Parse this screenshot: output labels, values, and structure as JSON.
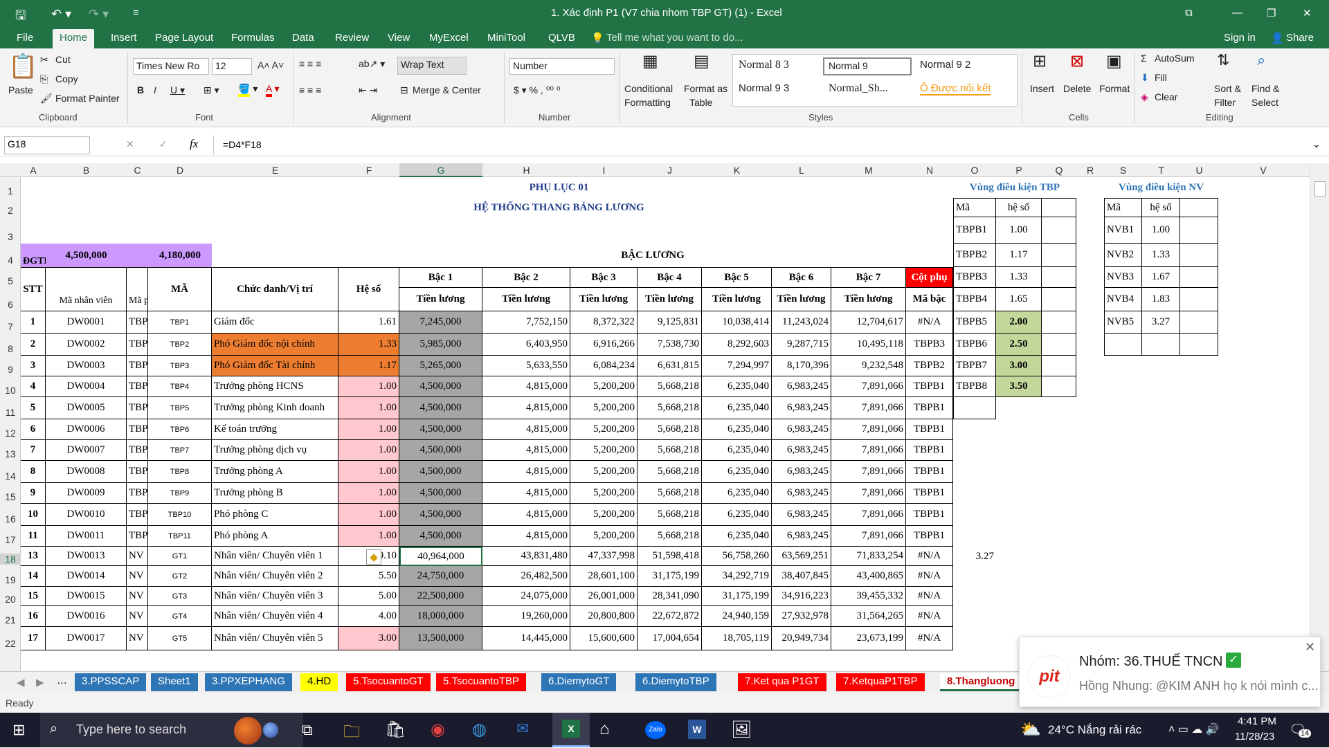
{
  "window": {
    "title": "1. Xác định P1  (V7 chia nhom TBP GT) (1) - Excel"
  },
  "menu": [
    "File",
    "Home",
    "Insert",
    "Page Layout",
    "Formulas",
    "Data",
    "Review",
    "View",
    "MyExcel",
    "MiniTool",
    "QLVB"
  ],
  "tell_me": "Tell me what you want to do...",
  "sign_in": "Sign in",
  "share": "Share",
  "ribbon": {
    "paste": "Paste",
    "cut": "Cut",
    "copy": "Copy",
    "format_painter": "Format Painter",
    "clipboard": "Clipboard",
    "font_name": "Times New Ro",
    "font_size": "12",
    "font": "Font",
    "wrap_text": "Wrap Text",
    "merge_center": "Merge & Center",
    "alignment": "Alignment",
    "number_format": "Number",
    "number": "Number",
    "conditional": "Conditional",
    "formatting": "Formatting",
    "format_as": "Format as",
    "table": "Table",
    "styles_list": [
      "Normal 8 3",
      "Normal 9",
      "Normal 9 2",
      "Normal 9 3",
      "Normal_Sh...",
      "Ô Được nối kết"
    ],
    "styles": "Styles",
    "insert": "Insert",
    "delete": "Delete",
    "format": "Format",
    "cells": "Cells",
    "autosum": "AutoSum",
    "fill": "Fill",
    "clear": "Clear",
    "sort_filter": "Sort &",
    "filter": "Filter",
    "find_select": "Find &",
    "select": "Select",
    "editing": "Editing"
  },
  "namebox": "G18",
  "formula": "=D4*F18",
  "columns": [
    "A",
    "B",
    "C",
    "D",
    "E",
    "F",
    "G",
    "H",
    "I",
    "J",
    "K",
    "L",
    "M",
    "N",
    "O",
    "P",
    "Q",
    "R",
    "S",
    "T",
    "U",
    "V"
  ],
  "rows": [
    "1",
    "2",
    "3",
    "4",
    "5",
    "6",
    "7",
    "8",
    "9",
    "10",
    "11",
    "12",
    "13",
    "14",
    "15",
    "16",
    "17",
    "18",
    "19",
    "20",
    "21",
    "22"
  ],
  "header": {
    "title1": "PHỤ LỤC 01",
    "title2": "HỆ THỐNG THANG BẢNG LƯƠNG",
    "bac_luong": "BẬC LƯƠNG",
    "dgtl": "ĐGTL",
    "dgtl_val1": "4,500,000",
    "dgtl_val2": "4,180,000",
    "stt": "STT",
    "ma_nv": "Mã nhân viên",
    "ma_ph": "Mã ph",
    "ma": "MÃ",
    "chuc_danh": "Chức danh/Vị trí",
    "he_so": "Hệ số",
    "bac": [
      "Bậc  1",
      "Bậc  2",
      "Bậc  3",
      "Bậc  4",
      "Bậc  5",
      "Bậc  6",
      "Bậc  7"
    ],
    "tien_luong": "Tiền lương",
    "cot_phu": "Cột phụ",
    "ma_bac": "Mã bậc"
  },
  "data_rows": [
    [
      "1",
      "DW0001",
      "TBP",
      "TBP1",
      "Giám đốc",
      "1.61",
      "7,245,000",
      "7,752,150",
      "8,372,322",
      "9,125,831",
      "10,038,414",
      "11,243,024",
      "12,704,617",
      "#N/A"
    ],
    [
      "2",
      "DW0002",
      "TBP",
      "TBP2",
      "Phó Giám đốc nội chính",
      "1.33",
      "5,985,000",
      "6,403,950",
      "6,916,266",
      "7,538,730",
      "8,292,603",
      "9,287,715",
      "10,495,118",
      "TBPB3"
    ],
    [
      "3",
      "DW0003",
      "TBP",
      "TBP3",
      "Phó Giám đốc Tài chính",
      "1.17",
      "5,265,000",
      "5,633,550",
      "6,084,234",
      "6,631,815",
      "7,294,997",
      "8,170,396",
      "9,232,548",
      "TBPB2"
    ],
    [
      "4",
      "DW0004",
      "TBP",
      "TBP4",
      "Trưởng phòng HCNS",
      "1.00",
      "4,500,000",
      "4,815,000",
      "5,200,200",
      "5,668,218",
      "6,235,040",
      "6,983,245",
      "7,891,066",
      "TBPB1"
    ],
    [
      "5",
      "DW0005",
      "TBP",
      "TBP5",
      "Trưởng phòng Kinh doanh",
      "1.00",
      "4,500,000",
      "4,815,000",
      "5,200,200",
      "5,668,218",
      "6,235,040",
      "6,983,245",
      "7,891,066",
      "TBPB1"
    ],
    [
      "6",
      "DW0006",
      "TBP",
      "TBP6",
      "Kế toán trưởng",
      "1.00",
      "4,500,000",
      "4,815,000",
      "5,200,200",
      "5,668,218",
      "6,235,040",
      "6,983,245",
      "7,891,066",
      "TBPB1"
    ],
    [
      "7",
      "DW0007",
      "TBP",
      "TBP7",
      "Trưởng phòng dịch vụ",
      "1.00",
      "4,500,000",
      "4,815,000",
      "5,200,200",
      "5,668,218",
      "6,235,040",
      "6,983,245",
      "7,891,066",
      "TBPB1"
    ],
    [
      "8",
      "DW0008",
      "TBP",
      "TBP8",
      "Trưởng phòng A",
      "1.00",
      "4,500,000",
      "4,815,000",
      "5,200,200",
      "5,668,218",
      "6,235,040",
      "6,983,245",
      "7,891,066",
      "TBPB1"
    ],
    [
      "9",
      "DW0009",
      "TBP",
      "TBP9",
      "Trưởng phòng B",
      "1.00",
      "4,500,000",
      "4,815,000",
      "5,200,200",
      "5,668,218",
      "6,235,040",
      "6,983,245",
      "7,891,066",
      "TBPB1"
    ],
    [
      "10",
      "DW0010",
      "TBP",
      "TBP10",
      "Phó phòng C",
      "1.00",
      "4,500,000",
      "4,815,000",
      "5,200,200",
      "5,668,218",
      "6,235,040",
      "6,983,245",
      "7,891,066",
      "TBPB1"
    ],
    [
      "11",
      "DW0011",
      "TBP",
      "TBP11",
      "Phó phòng A",
      "1.00",
      "4,500,000",
      "4,815,000",
      "5,200,200",
      "5,668,218",
      "6,235,040",
      "6,983,245",
      "7,891,066",
      "TBPB1"
    ],
    [
      "13",
      "DW0013",
      "NV",
      "GT1",
      "Nhân viên/ Chuyên viên 1",
      "9.10",
      "40,964,000",
      "43,831,480",
      "47,337,998",
      "51,598,418",
      "56,758,260",
      "63,569,251",
      "71,833,254",
      "#N/A"
    ],
    [
      "14",
      "DW0014",
      "NV",
      "GT2",
      "Nhân viên/ Chuyên viên 2",
      "5.50",
      "24,750,000",
      "26,482,500",
      "28,601,100",
      "31,175,199",
      "34,292,719",
      "38,407,845",
      "43,400,865",
      "#N/A"
    ],
    [
      "15",
      "DW0015",
      "NV",
      "GT3",
      "Nhân viên/ Chuyên viên 3",
      "5.00",
      "22,500,000",
      "24,075,000",
      "26,001,000",
      "28,341,090",
      "31,175,199",
      "34,916,223",
      "39,455,332",
      "#N/A"
    ],
    [
      "16",
      "DW0016",
      "NV",
      "GT4",
      "Nhân viên/ Chuyên viên 4",
      "4.00",
      "18,000,000",
      "19,260,000",
      "20,800,800",
      "22,672,872",
      "24,940,159",
      "27,932,978",
      "31,564,265",
      "#N/A"
    ],
    [
      "17",
      "DW0017",
      "NV",
      "GT5",
      "Nhân viên/ Chuyên viên 5",
      "3.00",
      "13,500,000",
      "14,445,000",
      "15,600,600",
      "17,004,654",
      "18,705,119",
      "20,949,734",
      "23,673,199",
      "#N/A"
    ]
  ],
  "tbp_region": {
    "title": "Vùng điều kiện TBP",
    "h1": "Mã",
    "h2": "hệ số",
    "rows": [
      [
        "TBPB1",
        "1.00"
      ],
      [
        "TBPB2",
        "1.17"
      ],
      [
        "TBPB3",
        "1.33"
      ],
      [
        "TBPB4",
        "1.65"
      ],
      [
        "TBPB5",
        "2.00"
      ],
      [
        "TBPB6",
        "2.50"
      ],
      [
        "TBPB7",
        "3.00"
      ],
      [
        "TBPB8",
        "3.50"
      ]
    ]
  },
  "nv_region": {
    "title": "Vùng điều kiện NV",
    "h1": "Mã",
    "h2": "hệ số",
    "rows": [
      [
        "NVB1",
        "1.00"
      ],
      [
        "NVB2",
        "1.33"
      ],
      [
        "NVB3",
        "1.67"
      ],
      [
        "NVB4",
        "1.83"
      ],
      [
        "NVB5",
        "3.27"
      ]
    ]
  },
  "o18": "3.27",
  "sheet_tabs": [
    "3.PPSSCAP",
    "Sheet1",
    "3.PPXEPHANG",
    "4.HD",
    "5.TsocuantoGT",
    "5.TsocuantoTBP",
    "6.DiemytoGT",
    "6.DiemytoTBP",
    "7.Ket qua P1GT",
    "7.KetquaP1TBP",
    "8.Thangluong"
  ],
  "status": "Ready",
  "toast": {
    "group": "Nhóm: 36.THUẾ TNCN",
    "msg": "Hồng Nhung: @KIM ANH họ k nói mình c...",
    "logo": "pit"
  },
  "taskbar": {
    "search": "Type here to search",
    "weather": "24°C  Nắng rải rác",
    "time": "4:41 PM",
    "date": "11/28/23",
    "notif": "14"
  }
}
